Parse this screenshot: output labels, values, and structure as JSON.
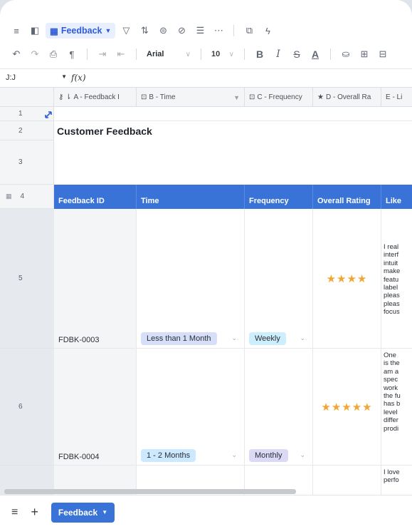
{
  "toolbar": {
    "sheet_name": "Feedback",
    "font": "Arial",
    "font_size": "10"
  },
  "formula_bar": {
    "cell_ref": "J:J",
    "fx_label": "f(x)"
  },
  "columns": [
    {
      "label": "A - Feedback I",
      "icon": "key-icon"
    },
    {
      "label": "B - Time",
      "icon": "select-icon"
    },
    {
      "label": "C - Frequency",
      "icon": "select-icon"
    },
    {
      "label": "D - Overall Ra",
      "icon": "rating-icon"
    },
    {
      "label": "E - Li",
      "icon": "text-icon"
    }
  ],
  "row_numbers": [
    "1",
    "2",
    "3",
    "4",
    "5",
    "6"
  ],
  "title": "Customer Feedback",
  "table_headers": [
    "Feedback ID",
    "Time",
    "Frequency",
    "Overall Rating",
    "Like"
  ],
  "rows": [
    {
      "id": "FDBK-0003",
      "time": "Less than 1 Month",
      "frequency": "Weekly",
      "rating": 4,
      "stars": "★★★★",
      "like_lines": [
        "I real",
        "interf",
        "intuit",
        "make",
        "featu",
        "label",
        "pleas",
        "pleas",
        "focus"
      ]
    },
    {
      "id": "FDBK-0004",
      "time": "1 - 2 Months",
      "frequency": "Monthly",
      "rating": 5,
      "stars": "★★★★★",
      "like_lines": [
        "One",
        "is the",
        "am a",
        "spec",
        "work",
        "the fu",
        "has b",
        "level",
        "differ",
        "prodi"
      ]
    },
    {
      "like_lines": [
        "I love",
        "perfo"
      ]
    }
  ],
  "bottom": {
    "tab_label": "Feedback"
  },
  "colors": {
    "accent": "#3a73d8",
    "star": "#f2a531"
  }
}
